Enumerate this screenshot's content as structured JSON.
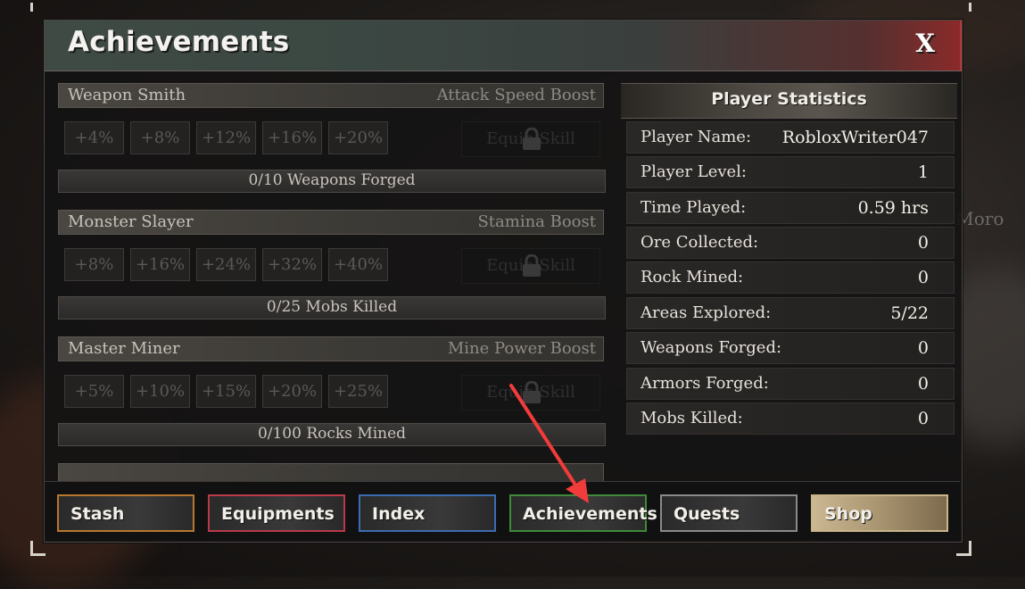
{
  "window": {
    "title": "Achievements",
    "close_label": "X"
  },
  "achievements": [
    {
      "name": "Weapon Smith",
      "reward": "Attack Speed Boost",
      "tiers": [
        "+4%",
        "+8%",
        "+12%",
        "+16%",
        "+20%"
      ],
      "equip_label": "Equip Skill",
      "progress": "0/10 Weapons Forged"
    },
    {
      "name": "Monster Slayer",
      "reward": "Stamina Boost",
      "tiers": [
        "+8%",
        "+16%",
        "+24%",
        "+32%",
        "+40%"
      ],
      "equip_label": "Equip Skill",
      "progress": "0/25 Mobs Killed"
    },
    {
      "name": "Master Miner",
      "reward": "Mine Power Boost",
      "tiers": [
        "+5%",
        "+10%",
        "+15%",
        "+20%",
        "+25%"
      ],
      "equip_label": "Equip Skill",
      "progress": "0/100 Rocks Mined"
    }
  ],
  "stats": {
    "title": "Player Statistics",
    "rows": [
      {
        "label": "Player Name:",
        "value": "RobloxWriter047"
      },
      {
        "label": "Player Level:",
        "value": "1"
      },
      {
        "label": "Time Played:",
        "value": "0.59 hrs"
      },
      {
        "label": "Ore Collected:",
        "value": "0"
      },
      {
        "label": "Rock Mined:",
        "value": "0"
      },
      {
        "label": "Areas Explored:",
        "value": "5/22"
      },
      {
        "label": "Weapons Forged:",
        "value": "0"
      },
      {
        "label": "Armors Forged:",
        "value": "0"
      },
      {
        "label": "Mobs Killed:",
        "value": "0"
      }
    ]
  },
  "tabs": [
    {
      "label": "Stash",
      "color": "#b8772e"
    },
    {
      "label": "Equipments",
      "color": "#b8394a"
    },
    {
      "label": "Index",
      "color": "#3c6cb0"
    },
    {
      "label": "Achievements",
      "color": "#3f8a3a"
    },
    {
      "label": "Quests",
      "color": "#8a8a8a"
    },
    {
      "label": "Shop",
      "color": "#c9b48a"
    }
  ],
  "background": {
    "npc_name": "Sensei Moro"
  },
  "annotation": {
    "arrow_color": "#f23b3b"
  }
}
